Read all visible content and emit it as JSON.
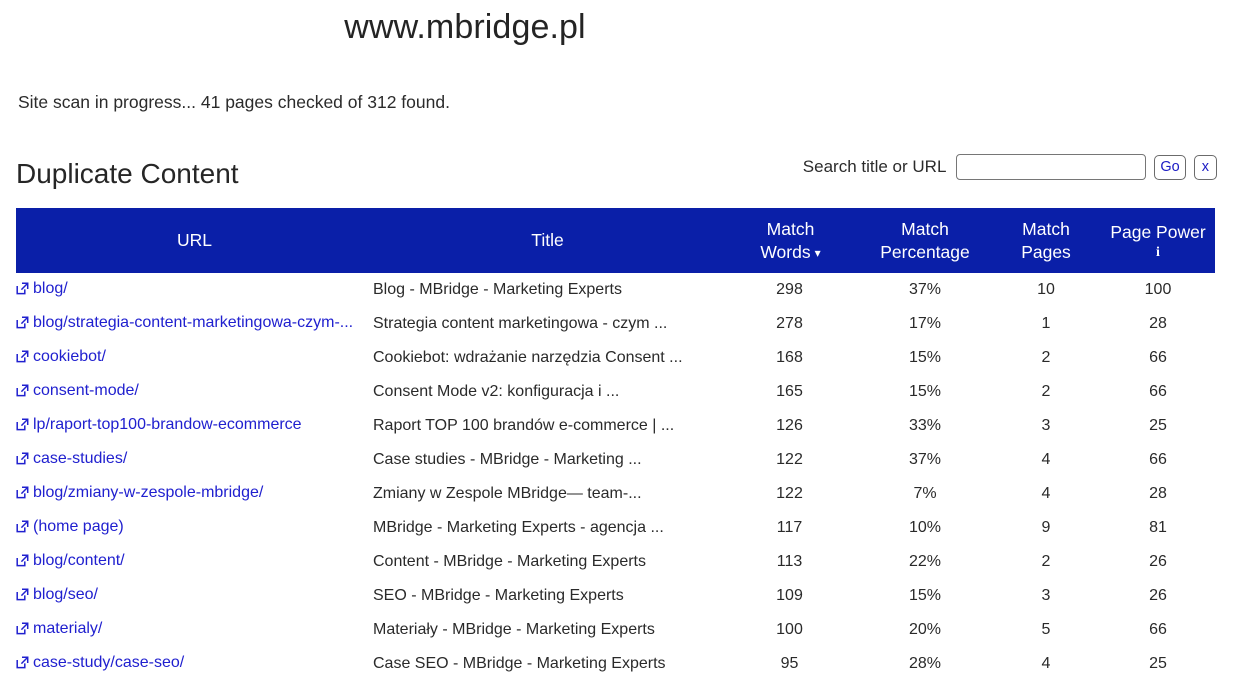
{
  "header": {
    "site_title": "www.mbridge.pl",
    "scan_status": "Site scan in progress... 41 pages checked of 312 found."
  },
  "section": {
    "heading": "Duplicate Content"
  },
  "search": {
    "label": "Search title or URL",
    "value": "",
    "placeholder": "",
    "go_label": "Go",
    "clear_label": "x"
  },
  "colors": {
    "header_blue": "#0A1FA8",
    "link_blue": "#2020cf",
    "button_text_blue": "#1b1bc4",
    "body_text": "#2a2a2a",
    "page_background": "#ffffff"
  },
  "table": {
    "columns": [
      {
        "key": "url",
        "label": "URL",
        "label2": "",
        "sorted": false
      },
      {
        "key": "title",
        "label": "Title",
        "label2": "",
        "sorted": false
      },
      {
        "key": "match_words",
        "label": "Match",
        "label2": "Words",
        "sorted": true,
        "sort_caret": "▾"
      },
      {
        "key": "match_percentage",
        "label": "Match",
        "label2": "Percentage",
        "sorted": false
      },
      {
        "key": "match_pages",
        "label": "Match",
        "label2": "Pages",
        "sorted": false
      },
      {
        "key": "page_power",
        "label": "Page Power",
        "label2": "",
        "sorted": false,
        "info": "i"
      }
    ],
    "rows": [
      {
        "url": "blog/",
        "title": "Blog - MBridge - Marketing Experts",
        "match_words": "298",
        "match_percentage": "37%",
        "match_pages": "10",
        "page_power": "100"
      },
      {
        "url": "blog/strategia-content-marketingowa-czym-...",
        "title": "Strategia content marketingowa - czym ...",
        "match_words": "278",
        "match_percentage": "17%",
        "match_pages": "1",
        "page_power": "28"
      },
      {
        "url": "cookiebot/",
        "title": "Cookiebot: wdrażanie narzędzia Consent ...",
        "match_words": "168",
        "match_percentage": "15%",
        "match_pages": "2",
        "page_power": "66"
      },
      {
        "url": "consent-mode/",
        "title": "Consent Mode v2: konfiguracja i ...",
        "match_words": "165",
        "match_percentage": "15%",
        "match_pages": "2",
        "page_power": "66"
      },
      {
        "url": "lp/raport-top100-brandow-ecommerce",
        "title": "Raport TOP 100 brandów e-commerce | ...",
        "match_words": "126",
        "match_percentage": "33%",
        "match_pages": "3",
        "page_power": "25"
      },
      {
        "url": "case-studies/",
        "title": "Case studies - MBridge - Marketing ...",
        "match_words": "122",
        "match_percentage": "37%",
        "match_pages": "4",
        "page_power": "66"
      },
      {
        "url": "blog/zmiany-w-zespole-mbridge/",
        "title": "Zmiany w Zespole MBridge— team-...",
        "match_words": "122",
        "match_percentage": "7%",
        "match_pages": "4",
        "page_power": "28"
      },
      {
        "url": "(home page)",
        "title": "MBridge - Marketing Experts - agencja ...",
        "match_words": "117",
        "match_percentage": "10%",
        "match_pages": "9",
        "page_power": "81"
      },
      {
        "url": "blog/content/",
        "title": "Content - MBridge - Marketing Experts",
        "match_words": "113",
        "match_percentage": "22%",
        "match_pages": "2",
        "page_power": "26"
      },
      {
        "url": "blog/seo/",
        "title": "SEO - MBridge - Marketing Experts",
        "match_words": "109",
        "match_percentage": "15%",
        "match_pages": "3",
        "page_power": "26"
      },
      {
        "url": "materialy/",
        "title": "Materiały - MBridge - Marketing Experts",
        "match_words": "100",
        "match_percentage": "20%",
        "match_pages": "5",
        "page_power": "66"
      },
      {
        "url": "case-study/case-seo/",
        "title": "Case SEO - MBridge - Marketing Experts",
        "match_words": "95",
        "match_percentage": "28%",
        "match_pages": "4",
        "page_power": "25"
      }
    ]
  },
  "icons": {
    "external_link": "external-link-icon",
    "sort_descending": "caret-down-icon",
    "info": "info-icon"
  }
}
